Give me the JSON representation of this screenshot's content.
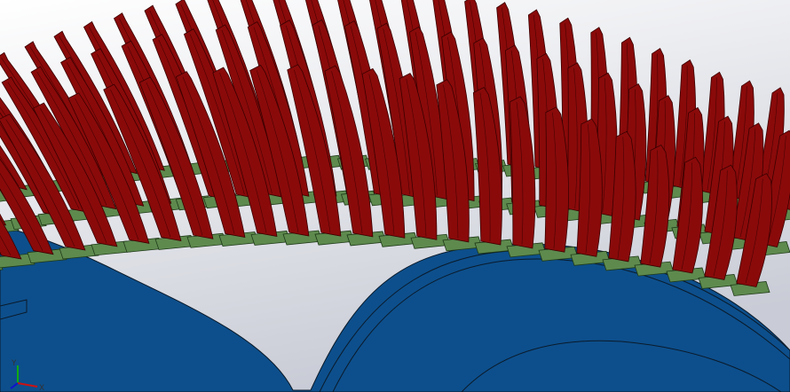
{
  "viewport": {
    "background_top": "#ffffff",
    "background_bottom": "#c9ccd6"
  },
  "model": {
    "blade_color": "#8a0a0a",
    "blade_edge": "#3a0000",
    "disk_color": "#0d4f8c",
    "disk_edge": "#072a4e",
    "platform_color": "#5e8a4e",
    "platform_edge": "#1f3a18",
    "edge_line": "#0a1a2a"
  },
  "triad": {
    "x_label": "X",
    "y_label": "Y",
    "x_color": "#cc1111",
    "y_color": "#11aa11",
    "z_color": "#1111cc"
  }
}
